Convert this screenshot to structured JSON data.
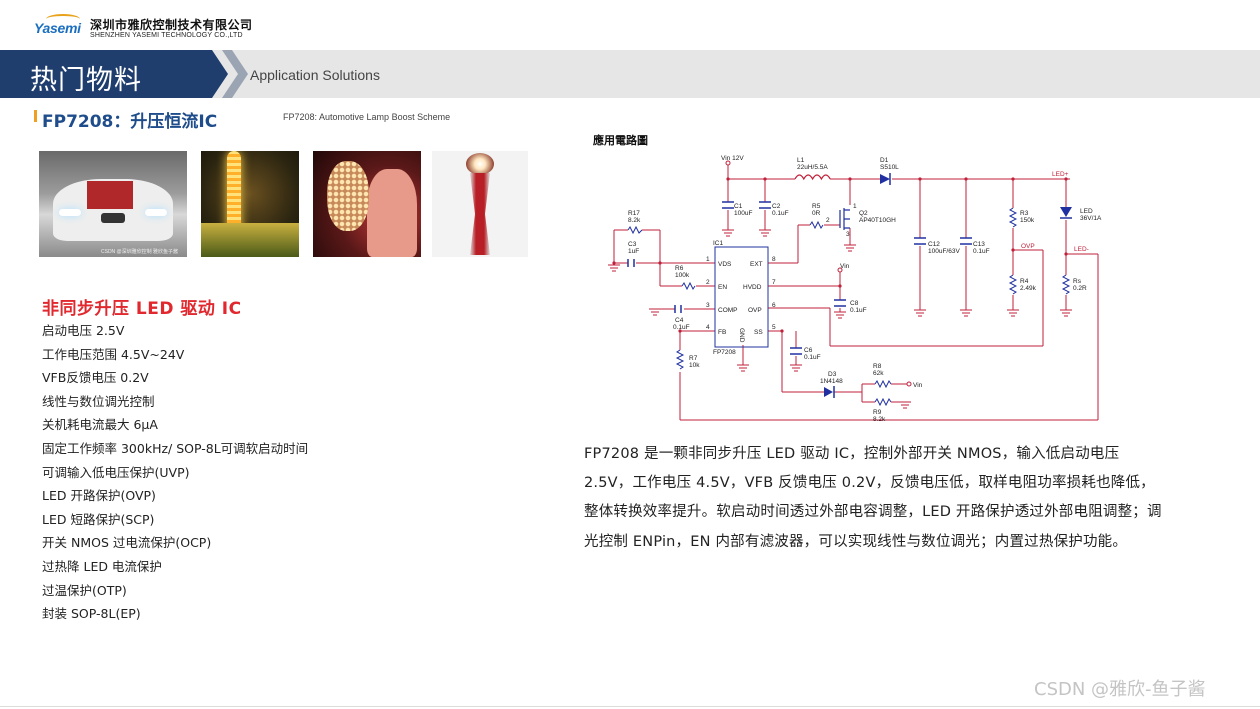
{
  "header": {
    "logo_text": "Yasemi",
    "company_cn": "深圳市雅欣控制技术有限公司",
    "company_en": "SHENZHEN YASEMI TECHNOLOGY CO.,LTD"
  },
  "banner": {
    "title": "热门物料",
    "subtitle": "Application Solutions"
  },
  "section": {
    "title": "FP7208：升压恒流IC",
    "subtitle": "FP7208: Automotive Lamp Boost Scheme"
  },
  "photos": [
    {
      "icon": "car-headlight-photo",
      "caption": "CSDN @深圳雅欣控制 雅欣鱼子酱"
    },
    {
      "icon": "led-strip-photo"
    },
    {
      "icon": "led-mask-photo"
    },
    {
      "icon": "lamp-photo"
    }
  ],
  "features": {
    "title": "非同步升压 LED 驱动 IC",
    "items": [
      "启动电压 2.5V",
      "工作电压范围 4.5V~24V",
      "VFB反馈电压 0.2V",
      "线性与数位调光控制",
      "关机耗电流最大 6μA",
      "固定工作频率 300kHz/ SOP-8L可调软启动时间",
      "可调输入低电压保护(UVP)",
      "LED 开路保护(OVP)",
      "LED 短路保护(SCP)",
      "开关 NMOS 过电流保护(OCP)",
      "过热降 LED 电流保护",
      "过温保护(OTP)",
      "封装 SOP-8L(EP)"
    ]
  },
  "schematic": {
    "title": "應用電路圖",
    "labels": {
      "vin12": "Vin 12V",
      "l1": "L1",
      "l1_val": "22uH/5.5A",
      "d1": "D1",
      "d1_val": "S510L",
      "ledp": "LED+",
      "ledm": "LED-",
      "led": "LED",
      "led_val": "36V/1A",
      "c1": "C1",
      "c1_val": "100uF",
      "c2": "C2",
      "c2_val": "0.1uF",
      "r5": "R5",
      "r5_val": "0R",
      "q2": "Q2",
      "q2_val": "AP40T10GH",
      "r17": "R17",
      "r17_val": "8.2k",
      "c3": "C3",
      "c3_val": "1uF",
      "ic1": "IC1",
      "pin_vds": "VDS",
      "pin_en": "EN",
      "pin_comp": "COMP",
      "pin_fb": "FB",
      "pin_ext": "EXT",
      "pin_hvdd": "HVDD",
      "pin_ovp": "OVP",
      "pin_ss": "SS",
      "pin_gnd": "GND",
      "ic_name": "FP7208",
      "r6": "R6",
      "r6_val": "100k",
      "c4": "C4",
      "c4_val": "0.1uF",
      "r7": "R7",
      "r7_val": "10k",
      "vin": "Vin",
      "c8": "C8",
      "c8_val": "0.1uF",
      "c6": "C6",
      "c6_val": "0.1uF",
      "d3": "D3",
      "d3_val": "1N4148",
      "r8": "R8",
      "r8_val": "62k",
      "r9": "R9",
      "r9_val": "8.2k",
      "vin2": "Vin",
      "c12": "C12",
      "c12_val": "100uF/63V",
      "c13": "C13",
      "c13_val": "0.1uF",
      "r3": "R3",
      "r3_val": "150k",
      "r4": "R4",
      "r4_val": "2.49k",
      "ovp": "OVP",
      "rs": "Rs",
      "rs_val": "0.2R",
      "p1": "1",
      "p2": "2",
      "p3": "3",
      "p4": "4",
      "p5": "5",
      "p6": "6",
      "p7": "7",
      "p8": "8",
      "q_g": "1",
      "q_d": "2",
      "q_s": "3"
    }
  },
  "description": "FP7208 是一颗非同步升压 LED 驱动 IC，控制外部开关 NMOS，输入低启动电压 2.5V，工作电压 4.5V，VFB 反馈电压 0.2V，反馈电压低，取样电阻功率损耗也降低，整体转换效率提升。软启动时间透过外部电容调整，LED 开路保护透过外部电阻调整；调光控制 ENPin，EN 内部有滤波器，可以实现线性与数位调光；内置过热保护功能。",
  "watermark": "CSDN @雅欣-鱼子酱",
  "colors": {
    "banner_blue": "#1f3e6e",
    "title_blue": "#1f4d8c",
    "feature_red": "#e0282e",
    "accent_orange": "#f0a020",
    "wire_red": "#c0203a",
    "wire_blue": "#2030a0"
  }
}
